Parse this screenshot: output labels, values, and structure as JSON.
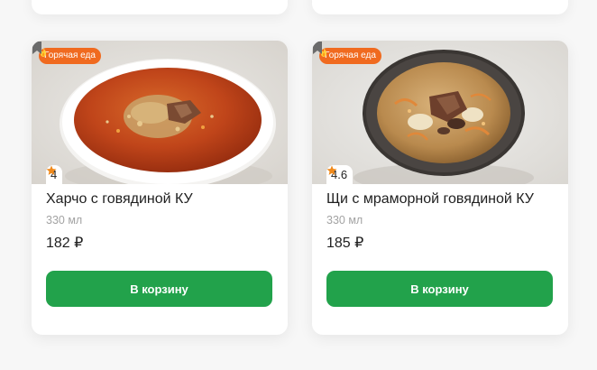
{
  "colors": {
    "accent_green": "#22a24b",
    "badge_orange": "#f06a1f",
    "star_orange": "#f08a1c"
  },
  "products": [
    {
      "badge": "Горячая еда",
      "badge_icon": "fire-icon",
      "rating": "4",
      "title": "Харчо с говядиной КУ",
      "volume": "330 мл",
      "price": "182 ₽",
      "button": "В корзину"
    },
    {
      "badge": "Горячая еда",
      "badge_icon": "fire-icon",
      "rating": "4.6",
      "title": "Щи с мраморной говядиной КУ",
      "volume": "330 мл",
      "price": "185 ₽",
      "button": "В корзину"
    }
  ]
}
